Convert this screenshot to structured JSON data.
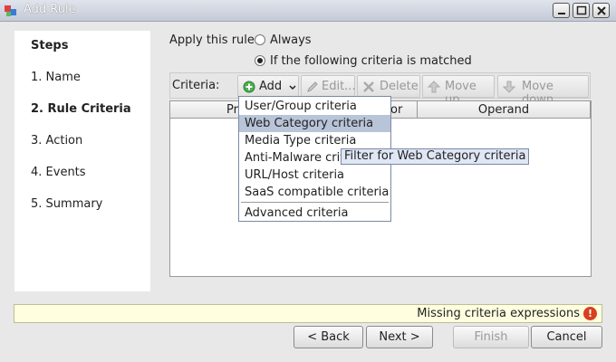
{
  "window": {
    "title": "Add Rule"
  },
  "steps": {
    "heading": "Steps",
    "items": [
      "1. Name",
      "2. Rule Criteria",
      "3. Action",
      "4. Events",
      "5. Summary"
    ]
  },
  "apply": {
    "label": "Apply this rule:",
    "options": [
      "Always",
      "If the following criteria is matched"
    ],
    "selected": "If the following criteria is matched"
  },
  "toolbar": {
    "criteria_label": "Criteria:",
    "add": "Add",
    "edit": "Edit...",
    "delete": "Delete",
    "move_up": "Move up",
    "move_down": "Move down"
  },
  "table": {
    "columns": [
      "Property",
      "Operator",
      "Operand"
    ],
    "visible_headers": [
      "Pro",
      "or",
      "Operand"
    ]
  },
  "add_menu": {
    "items": [
      "User/Group criteria",
      "Web Category criteria",
      "Media Type criteria",
      "Anti-Malware crite",
      "URL/Host criteria",
      "SaaS compatible criteria"
    ],
    "advanced": "Advanced criteria",
    "highlighted": "Web Category criteria"
  },
  "tooltip": "Filter for Web Category criteria",
  "status": {
    "message": "Missing criteria expressions",
    "icon": "warning-icon"
  },
  "buttons": {
    "back": "< Back",
    "next": "Next >",
    "finish": "Finish",
    "cancel": "Cancel"
  },
  "colors": {
    "highlight": "#b8c4d8",
    "status_bg": "#ffffe0",
    "warning": "#d8401f"
  }
}
